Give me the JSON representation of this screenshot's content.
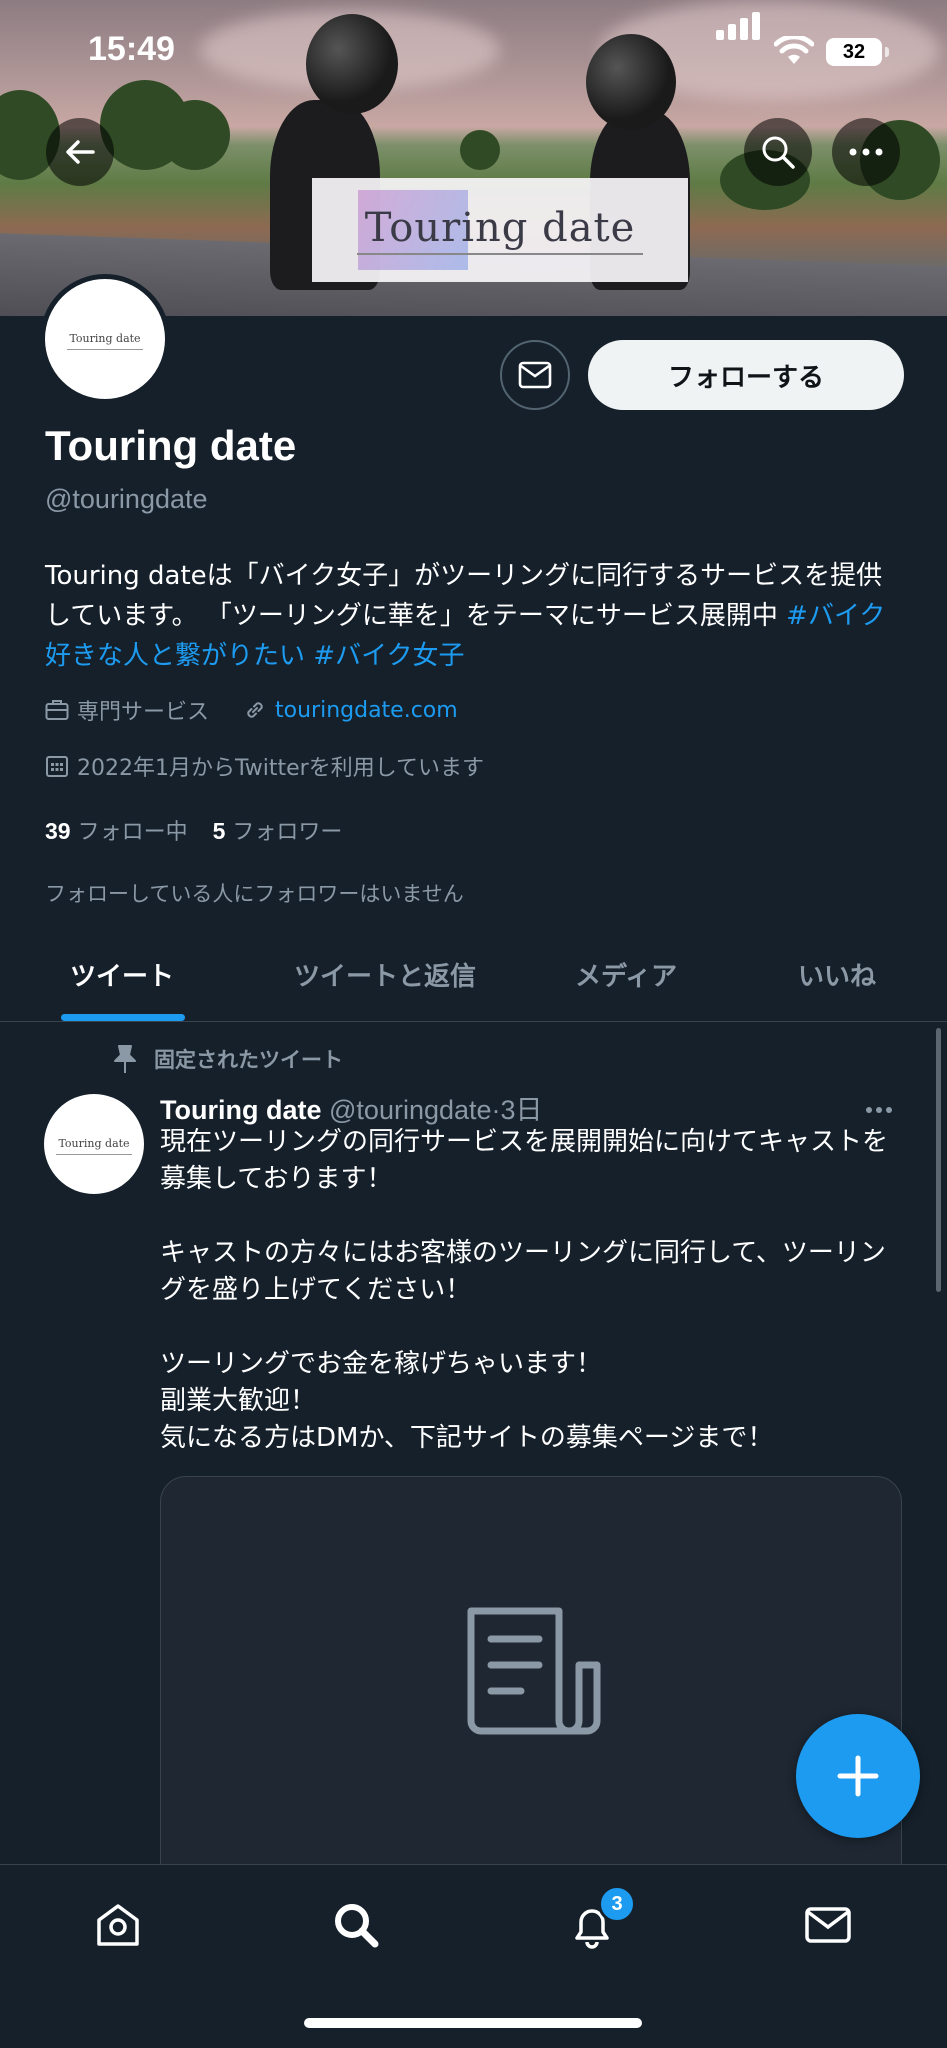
{
  "status_bar": {
    "time": "15:49",
    "battery": "32"
  },
  "banner": {
    "logo_text": "Touring date"
  },
  "profile": {
    "avatar_logo_text": "Touring date",
    "follow_label": "フォローする",
    "display_name": "Touring date",
    "handle": "@touringdate",
    "bio_text": "Touring dateは「バイク女子」がツーリングに同行するサービスを提供しています。 「ツーリングに華を」をテーマにサービス展開中 ",
    "bio_tags": [
      "#バイク好きな人と繋がりたい",
      "#バイク女子"
    ],
    "category": "専門サービス",
    "website": "touringdate.com",
    "joined": "2022年1月からTwitterを利用しています",
    "following_count": "39",
    "following_label": "フォロー中",
    "followers_count": "5",
    "followers_label": "フォロワー",
    "no_followers_note": "フォローしている人にフォロワーはいません"
  },
  "tabs": [
    {
      "label": "ツイート",
      "active": true
    },
    {
      "label": "ツイートと返信",
      "active": false
    },
    {
      "label": "メディア",
      "active": false
    },
    {
      "label": "いいね",
      "active": false
    }
  ],
  "pinned_tweet": {
    "pinned_label": "固定されたツイート",
    "author_name": "Touring date",
    "author_handle": "@touringdate",
    "time": "3日",
    "text": "現在ツーリングの同行サービスを展開開始に向けてキャストを募集しております！\n\nキャストの方々にはお客様のツーリングに同行して、ツーリングを盛り上げてください！\n\nツーリングでお金を稼げちゃいます！\n副業大歓迎！\n気になる方はDMか、下記サイトの募集ページまで！"
  },
  "bottom_nav": {
    "notifications_badge": "3"
  },
  "colors": {
    "background": "#15202b",
    "accent": "#1d9bf0",
    "secondary_text": "#8b98a5",
    "border": "#38444d"
  }
}
